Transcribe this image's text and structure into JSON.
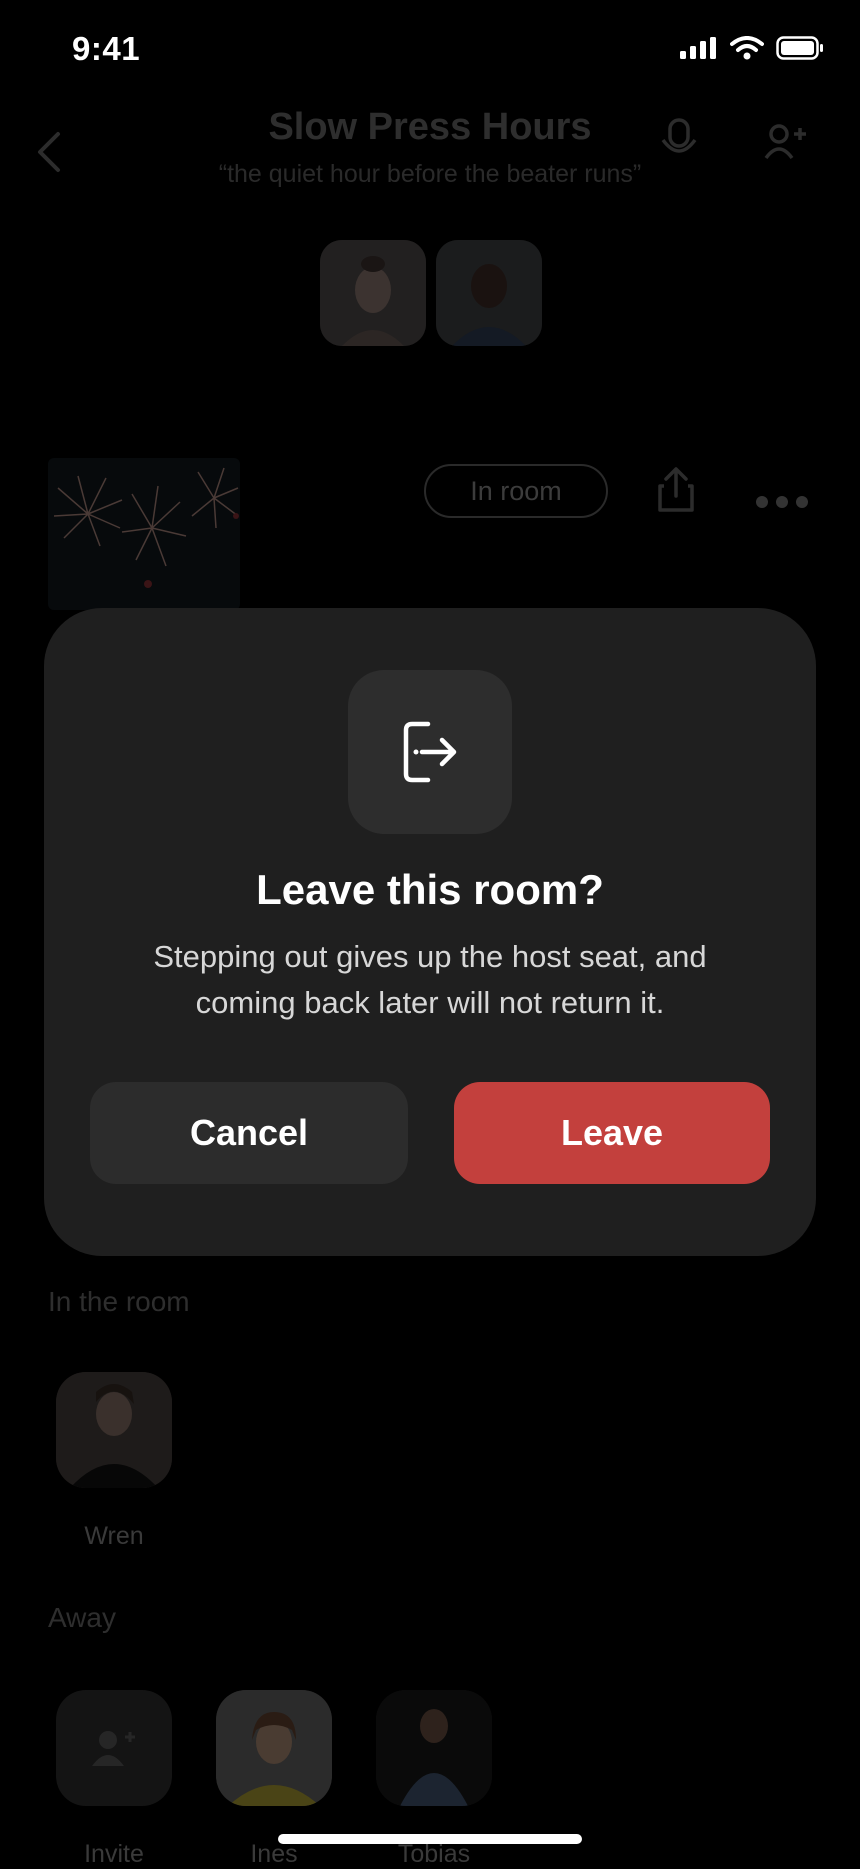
{
  "status_bar": {
    "time": "9:41"
  },
  "header": {
    "title": "Slow Press Hours",
    "subtitle": "“the quiet hour before the beater runs”"
  },
  "room": {
    "status_pill": "In room"
  },
  "sections": {
    "in_room_label": "In the room",
    "away_label": "Away"
  },
  "in_room_people": [
    {
      "name": "Wren"
    }
  ],
  "away_people": [
    {
      "name": "Invite"
    },
    {
      "name": "Ines"
    },
    {
      "name": "Tobias"
    }
  ],
  "modal": {
    "title": "Leave this room?",
    "body": "Stepping out gives up the host seat, and coming back later will not return it.",
    "cancel_label": "Cancel",
    "leave_label": "Leave",
    "icon": "leave-door-icon"
  },
  "colors": {
    "leave_button": "#c3403d",
    "modal_bg": "#1f1f1f",
    "cancel_button": "#2c2c2c"
  }
}
